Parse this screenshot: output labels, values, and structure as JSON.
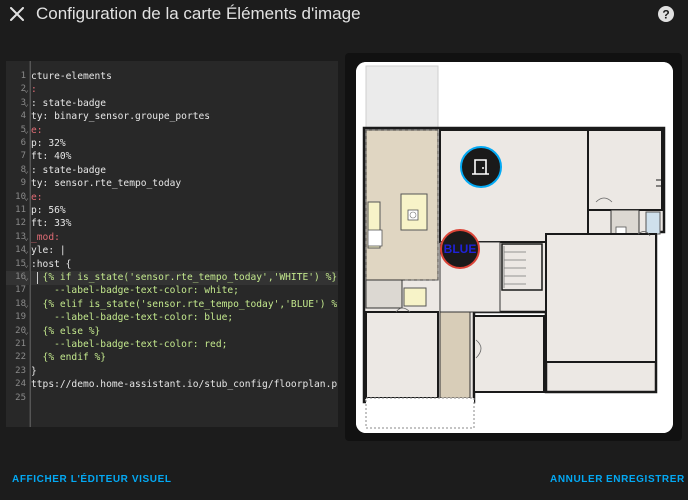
{
  "header": {
    "title": "Configuration de la carte Éléments d'image",
    "close_icon": "close-icon",
    "help_icon": "help-circle-icon"
  },
  "editor": {
    "lines": [
      {
        "n": "1",
        "fold": "",
        "code": "cture-elements"
      },
      {
        "n": "2",
        "fold": "⌄",
        "code": ":"
      },
      {
        "n": "3",
        "fold": "⌄",
        "code": ": state-badge"
      },
      {
        "n": "4",
        "fold": "",
        "code": "ty: binary_sensor.groupe_portes"
      },
      {
        "n": "5",
        "fold": "⌄",
        "code": "e:"
      },
      {
        "n": "6",
        "fold": "",
        "code": "p: 32%"
      },
      {
        "n": "7",
        "fold": "",
        "code": "ft: 40%"
      },
      {
        "n": "8",
        "fold": "⌄",
        "code": ": state-badge"
      },
      {
        "n": "9",
        "fold": "",
        "code": "ty: sensor.rte_tempo_today"
      },
      {
        "n": "10",
        "fold": "⌄",
        "code": "e:"
      },
      {
        "n": "11",
        "fold": "",
        "code": "p: 56%"
      },
      {
        "n": "12",
        "fold": "",
        "code": "ft: 33%"
      },
      {
        "n": "13",
        "fold": "⌄",
        "code": "_mod:"
      },
      {
        "n": "14",
        "fold": "⌄",
        "code": "yle: |"
      },
      {
        "n": "15",
        "fold": "⌄",
        "code": ":host {"
      },
      {
        "n": "16",
        "fold": "⌄",
        "code": "  {% if is_state('sensor.rte_tempo_today','WHITE') %}"
      },
      {
        "n": "17",
        "fold": "",
        "code": "    --label-badge-text-color: white;"
      },
      {
        "n": "18",
        "fold": "⌄",
        "code": "  {% elif is_state('sensor.rte_tempo_today','BLUE') %}"
      },
      {
        "n": "19",
        "fold": "",
        "code": "    --label-badge-text-color: blue;"
      },
      {
        "n": "20",
        "fold": "⌄",
        "code": "  {% else %}"
      },
      {
        "n": "21",
        "fold": "",
        "code": "    --label-badge-text-color: red;"
      },
      {
        "n": "22",
        "fold": "",
        "code": "  {% endif %}"
      },
      {
        "n": "23",
        "fold": "",
        "code": "}"
      },
      {
        "n": "24",
        "fold": "",
        "code": "ttps://demo.home-assistant.io/stub_config/floorplan.png"
      },
      {
        "n": "25",
        "fold": "",
        "code": ""
      }
    ]
  },
  "preview": {
    "badge_door_icon": "door-icon",
    "badge_tempo_label": "BLUE"
  },
  "footer": {
    "visual_editor_label": "AFFICHER L'ÉDITEUR VISUEL",
    "cancel_label": "ANNULER",
    "save_label": "ENREGISTRER"
  },
  "colors": {
    "accent": "#03a9f4",
    "background": "#1c1c1c",
    "editor_bg": "#282828",
    "badge_ring_blue": "#03a9f4",
    "badge_ring_red": "#db4437"
  }
}
